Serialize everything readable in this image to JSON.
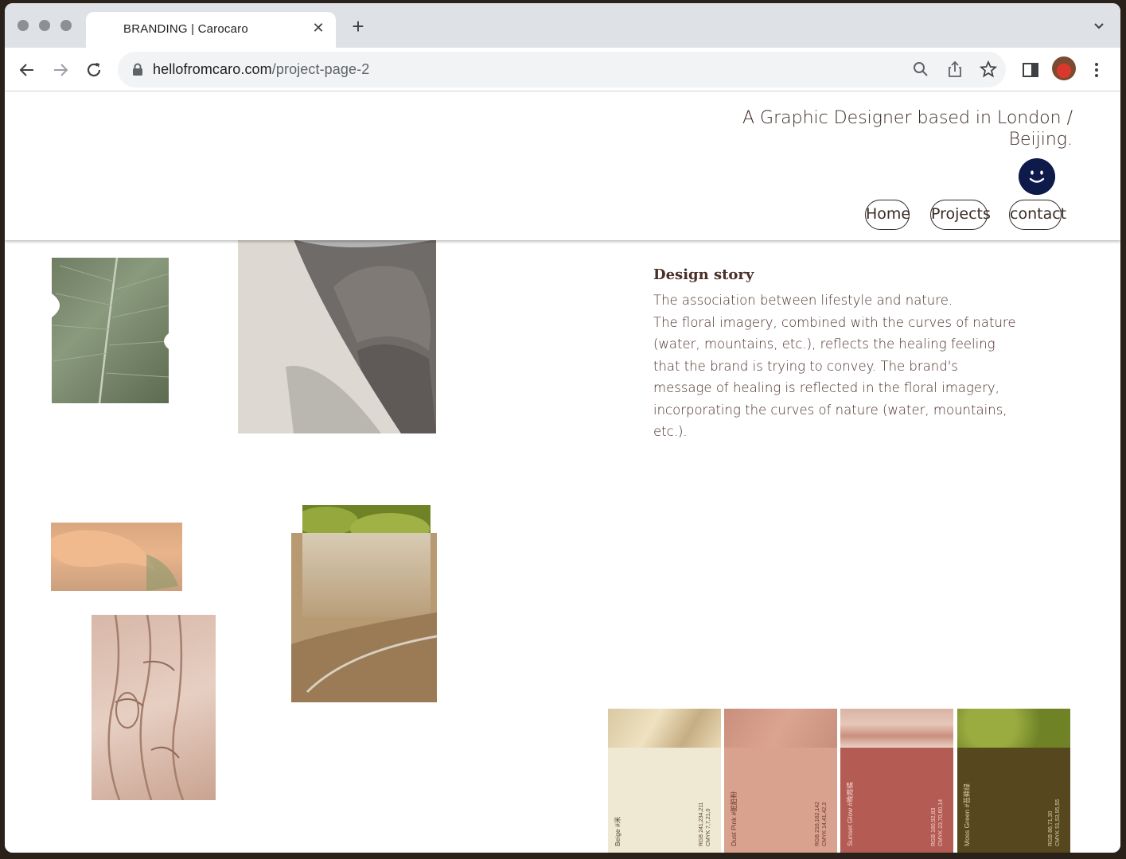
{
  "browser": {
    "tab_title": "BRANDING | Carocaro",
    "url_domain": "hellofromcaro.com",
    "url_path": "/project-page-2"
  },
  "site": {
    "tagline": "A Graphic Designer based in London / Beijing.",
    "nav": [
      "Home",
      "Projects",
      "contact"
    ]
  },
  "story": {
    "title": "Design story",
    "line1": "The association between lifestyle and nature.",
    "line2": "The floral imagery, combined with the curves of nature (water, mountains, etc.), reflects the healing feeling that the brand is trying to convey. The brand's message of healing is reflected in the floral imagery, incorporating the curves of nature (water, mountains, etc.)."
  },
  "palette": [
    {
      "name": "Beige #米",
      "rgb": "RGB 241,234,211",
      "cmyk": "CMYK 7,7,21,0",
      "color": "#efe8d3",
      "text": "#5b4a35"
    },
    {
      "name": "Dust Pink #脏脏粉",
      "rgb": "RGB 216,162,142",
      "cmyk": "CMYK 14,41,42,3",
      "color": "#d8a28e",
      "text": "#6a3a2c"
    },
    {
      "name": "Sunset Glow #晚霞橘",
      "rgb": "RGB 180,92,83",
      "cmyk": "CMYK 23,70,60,14",
      "color": "#b45c53",
      "text": "#f3d3cc"
    },
    {
      "name": "Moss Green #苔藓绿",
      "rgb": "RGB 86,71,30",
      "cmyk": "CMYK 51,53,95,55",
      "color": "#56471e",
      "text": "#d8cfae"
    }
  ],
  "colors": {
    "smiley": "#0d1a4a",
    "text": "#4a2e28"
  }
}
